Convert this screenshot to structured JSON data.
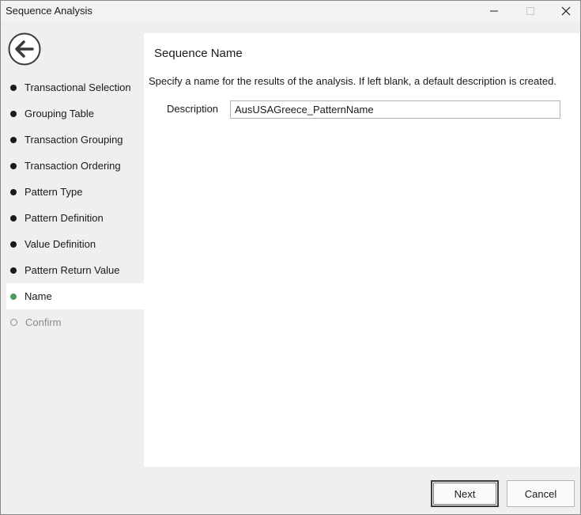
{
  "window": {
    "title": "Sequence Analysis",
    "controls": {
      "minimize_icon": "minimize-icon",
      "maximize_icon": "maximize-icon",
      "close_icon": "close-icon"
    }
  },
  "sidebar": {
    "back_icon": "back-arrow-icon",
    "items": [
      {
        "label": "Transactional Selection",
        "state": "done"
      },
      {
        "label": "Grouping Table",
        "state": "done"
      },
      {
        "label": "Transaction Grouping",
        "state": "done"
      },
      {
        "label": "Transaction Ordering",
        "state": "done"
      },
      {
        "label": "Pattern Type",
        "state": "done"
      },
      {
        "label": "Pattern Definition",
        "state": "done"
      },
      {
        "label": "Value Definition",
        "state": "done"
      },
      {
        "label": "Pattern Return Value",
        "state": "done"
      },
      {
        "label": "Name",
        "state": "active"
      },
      {
        "label": "Confirm",
        "state": "pending"
      }
    ]
  },
  "main": {
    "section_title": "Sequence Name",
    "instructions": "Specify a name for the results of the analysis. If left blank, a default description is created.",
    "description_label": "Description",
    "description_value": "AusUSAGreece_PatternName"
  },
  "footer": {
    "next_label": "Next",
    "cancel_label": "Cancel"
  },
  "colors": {
    "active_dot": "#4f9a5f",
    "done_dot": "#1a1a1a",
    "pending_dot": "#8a8a8a"
  }
}
